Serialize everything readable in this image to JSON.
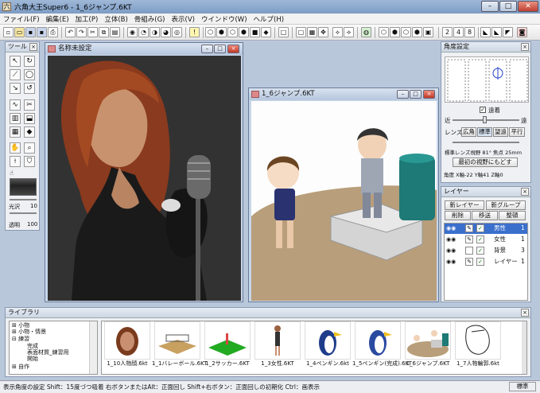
{
  "app": {
    "title": "六角大王Super6 - 1_6ジャンプ.6KT"
  },
  "menu": [
    "ファイル(F)",
    "編集(E)",
    "加工(P)",
    "立体(B)",
    "骨組み(G)",
    "表示(V)",
    "ウインドウ(W)",
    "ヘルプ(H)"
  ],
  "toolbar": {
    "nums": [
      "2",
      "4",
      "8"
    ]
  },
  "tools": {
    "title": "ツール",
    "gloss_label": "光沢",
    "gloss_value": "10",
    "alpha_label": "透明",
    "alpha_value": "100"
  },
  "win1": {
    "title": "名称未設定"
  },
  "win2": {
    "title": "1_6ジャンプ.6KT"
  },
  "angle": {
    "title": "角度設定",
    "perspective": "遠着",
    "near": "近",
    "far": "遠",
    "lens_label": "レンズ",
    "lens_btns": [
      "広角",
      "標準",
      "望遠",
      "平行"
    ],
    "lens_info": "標準レンズ視野 81° 焦点 25mm",
    "reset": "最初の視野にもどす",
    "angles": "角度 X軸-22 Y軸41 Z軸0"
  },
  "layers": {
    "title": "レイヤー",
    "btns": [
      "新レイヤー",
      "新グループ",
      "削除",
      "移送",
      "整頓"
    ],
    "rows": [
      {
        "icon": "eye",
        "name": "男性",
        "num": "1",
        "selected": true
      },
      {
        "icon": "eye",
        "name": "女性",
        "num": "1",
        "selected": false
      },
      {
        "icon": "eye",
        "name": "背景",
        "num": "3",
        "selected": false
      },
      {
        "icon": "eye",
        "name": "レイヤー",
        "num": "1",
        "selected": false
      }
    ]
  },
  "library": {
    "title": "ライブラリ",
    "tree": [
      "小物",
      "小物・情景",
      "練習",
      "完成",
      "表面材質_練習用",
      "開始",
      "自作"
    ],
    "items": [
      "1_10人物顔.6kt",
      "1_1バレーボール.6KT",
      "1_2サッカー.6KT",
      "1_3女性.6KT",
      "1_4ペンギン.6kt",
      "1_5ペンギン(完成).6KT",
      "1_6ジャンプ.6KT",
      "1_7人物輪郭.6kt"
    ]
  },
  "status": {
    "text": "表示角度の設定 Shift：15度づつ吸着 右ボタンまたはAlt：正面回し Shift+右ボタン：正面回しの初期化 Ctrl：画表示",
    "mode": "標準"
  }
}
